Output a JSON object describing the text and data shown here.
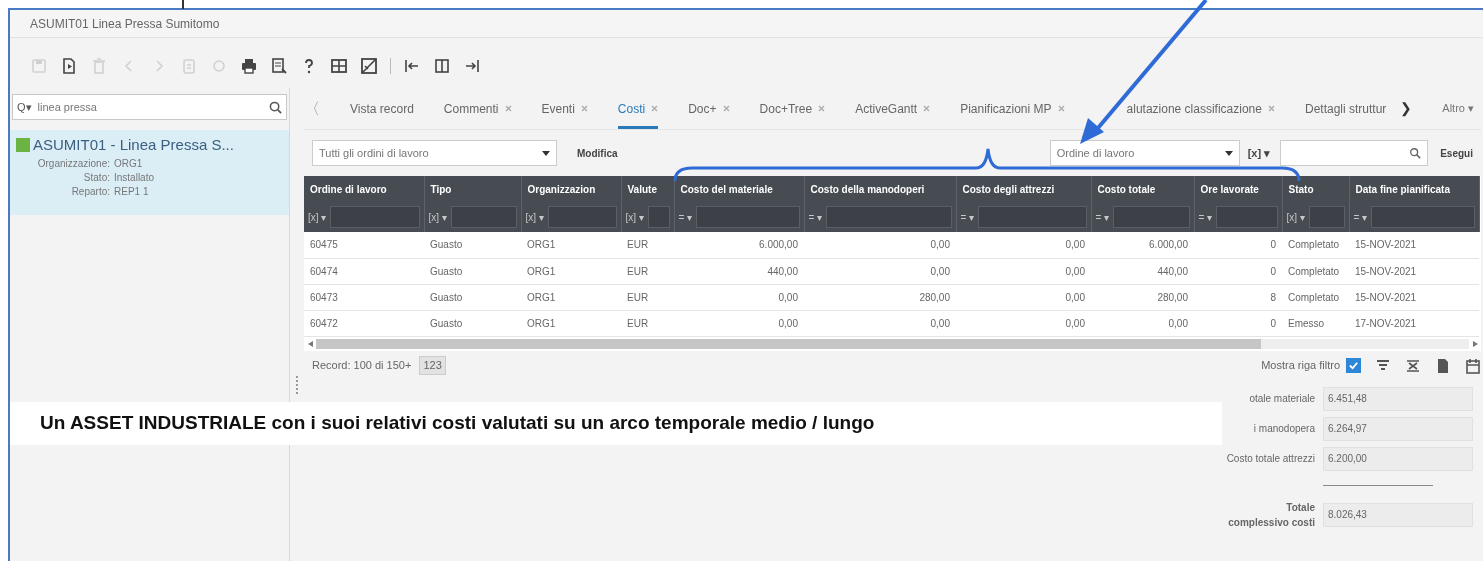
{
  "window": {
    "title": "ASUMIT01  Linea Pressa Sumitomo"
  },
  "toolbar": [
    {
      "kind": "save",
      "disabled": true
    },
    {
      "kind": "new",
      "disabled": false
    },
    {
      "kind": "delete",
      "disabled": true
    },
    {
      "kind": "prev",
      "disabled": true
    },
    {
      "kind": "next",
      "disabled": true
    },
    {
      "kind": "copy",
      "disabled": true
    },
    {
      "kind": "refresh",
      "disabled": true
    },
    {
      "kind": "print",
      "disabled": false
    },
    {
      "kind": "preview",
      "disabled": false
    },
    {
      "kind": "help",
      "disabled": false
    },
    {
      "kind": "book",
      "disabled": false
    },
    {
      "kind": "check",
      "disabled": false
    },
    {
      "kind": "separator"
    },
    {
      "kind": "first",
      "disabled": false
    },
    {
      "kind": "columns",
      "disabled": false
    },
    {
      "kind": "last",
      "disabled": false
    }
  ],
  "sidebar": {
    "search": {
      "prefix": "Q▾",
      "value": "linea pressa"
    },
    "items": [
      {
        "title": "ASUMIT01 - Linea Pressa S...",
        "selected": true,
        "fields": [
          {
            "label": "Organizzazione:",
            "value": "ORG1"
          },
          {
            "label": "Stato:",
            "value": "Installato"
          },
          {
            "label": "Reparto:",
            "value": "REP1 1"
          }
        ]
      }
    ]
  },
  "tabs": {
    "prev": "〈",
    "next": "❯",
    "more": "Altro ▾",
    "items": [
      {
        "label": "Vista record",
        "closable": false,
        "selected": false
      },
      {
        "label": "Commenti",
        "closable": true,
        "selected": false
      },
      {
        "label": "Eventi",
        "closable": true,
        "selected": false
      },
      {
        "label": "Costi",
        "closable": true,
        "selected": true
      },
      {
        "label": "Doc+",
        "closable": true,
        "selected": false
      },
      {
        "label": "Doc+Tree",
        "closable": true,
        "selected": false
      },
      {
        "label": "ActiveGantt",
        "closable": true,
        "selected": false
      },
      {
        "label": "Pianificazioni MP",
        "closable": true,
        "selected": false
      },
      {
        "label": "alutazione classificazione",
        "closable": true,
        "selected": false
      },
      {
        "label": "Dettagli struttur",
        "closable": false,
        "selected": false
      }
    ]
  },
  "filter_bar": {
    "view": "Tutti gli ordini di lavoro",
    "edit": "Modifica",
    "field": "Ordine di lavoro",
    "operator": "[x] ▾",
    "run": "Esegui"
  },
  "table": {
    "columns": [
      {
        "label": "Ordine di lavoro",
        "op": "[x] ▾"
      },
      {
        "label": "Tipo",
        "op": "[x] ▾"
      },
      {
        "label": "Organizzazion",
        "op": "[x] ▾"
      },
      {
        "label": "Valute",
        "op": "[x] ▾"
      },
      {
        "label": "Costo del materiale",
        "op": "= ▾"
      },
      {
        "label": "Costo della manodoperi",
        "op": "= ▾"
      },
      {
        "label": "Costo degli attrezzi",
        "op": "= ▾"
      },
      {
        "label": "Costo totale",
        "op": "= ▾"
      },
      {
        "label": "Ore lavorate",
        "op": "= ▾"
      },
      {
        "label": "Stato",
        "op": "[x] ▾"
      },
      {
        "label": "Data fine pianificata",
        "op": "= ▾"
      }
    ],
    "rows": [
      [
        "60475",
        "Guasto",
        "ORG1",
        "EUR",
        "6.000,00",
        "0,00",
        "0,00",
        "6.000,00",
        "0",
        "Completato",
        "15-NOV-2021"
      ],
      [
        "60474",
        "Guasto",
        "ORG1",
        "EUR",
        "440,00",
        "0,00",
        "0,00",
        "440,00",
        "0",
        "Completato",
        "15-NOV-2021"
      ],
      [
        "60473",
        "Guasto",
        "ORG1",
        "EUR",
        "0,00",
        "280,00",
        "0,00",
        "280,00",
        "8",
        "Completato",
        "15-NOV-2021"
      ],
      [
        "60472",
        "Guasto",
        "ORG1",
        "EUR",
        "0,00",
        "0,00",
        "0,00",
        "0,00",
        "0",
        "Emesso",
        "17-NOV-2021"
      ]
    ]
  },
  "footer": {
    "records": "Record: 100 di 150+",
    "count": "123",
    "show_filter": {
      "label": "Mostra riga filtro",
      "checked": true
    }
  },
  "summary": [
    {
      "label": "otale materiale",
      "value": "6.451,48"
    },
    {
      "label": "i manodopera",
      "value": "6.264,97"
    },
    {
      "label": "Costo totale attrezzi",
      "value": "6.200,00"
    },
    {
      "label": "Totale complessivo costi",
      "value": "8.026,43"
    }
  ],
  "caption": "Un ASSET INDUSTRIALE con i suoi relativi costi valutati su un arco temporale medio / lungo"
}
